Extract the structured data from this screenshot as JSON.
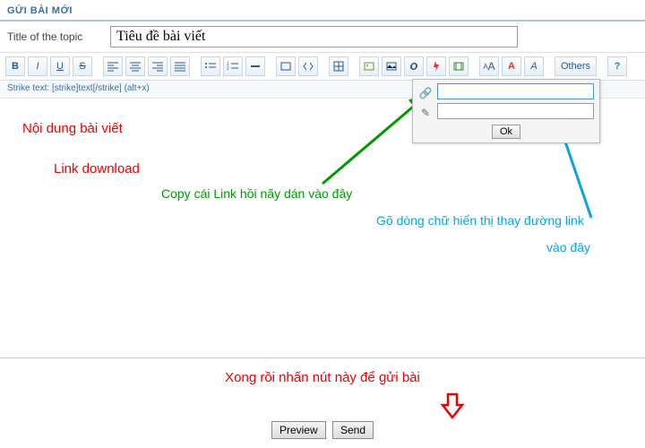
{
  "header": "GỬI BÀI MỚI",
  "title_label": "Title of the topic",
  "title_value": "Tiêu đề bài viết",
  "hint_text": "Strike text: [strike]text[/strike] (alt+x)",
  "toolbar": {
    "bold": "B",
    "italic": "I",
    "underline": "U",
    "strike": "S",
    "others": "Others"
  },
  "popup": {
    "ok": "Ok"
  },
  "annotations": {
    "content": "Nội dung bài viết",
    "link_dl": "Link download",
    "copy_link": "Copy cái Link hồi nãy dán vào đây",
    "type_text": "Gõ dòng chữ hiển thị thay đường link",
    "into_here": "vào đây",
    "send_hint": "Xong rồi nhấn nút này để gửi bài"
  },
  "footer": {
    "preview": "Preview",
    "send": "Send"
  }
}
